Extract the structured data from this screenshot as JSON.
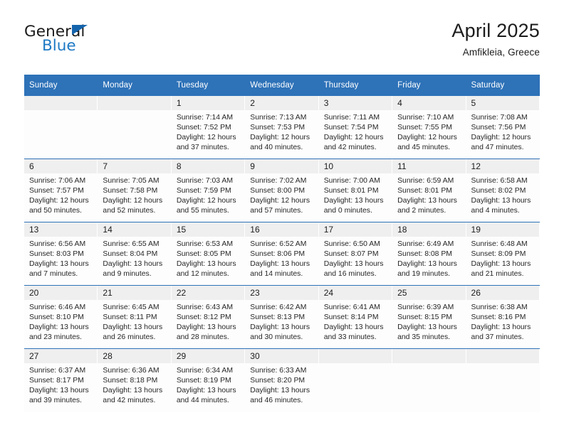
{
  "brand": {
    "name_top": "General",
    "name_bottom": "Blue",
    "triangle_color": "#1464ad",
    "blue_color": "#1f7ac4"
  },
  "header": {
    "title": "April 2025",
    "subtitle": "Amfikleia, Greece"
  },
  "theme": {
    "header_blue": "#2e72b8",
    "day_band_gray": "#efefef",
    "row_rule": "#2e72b8"
  },
  "weekday_headers": [
    "Sunday",
    "Monday",
    "Tuesday",
    "Wednesday",
    "Thursday",
    "Friday",
    "Saturday"
  ],
  "weeks": [
    [
      {
        "day": "",
        "sunrise": "",
        "sunset": "",
        "daylight1": "",
        "daylight2": "",
        "blank": true
      },
      {
        "day": "",
        "sunrise": "",
        "sunset": "",
        "daylight1": "",
        "daylight2": "",
        "blank": true
      },
      {
        "day": "1",
        "sunrise": "Sunrise: 7:14 AM",
        "sunset": "Sunset: 7:52 PM",
        "daylight1": "Daylight: 12 hours",
        "daylight2": "and 37 minutes."
      },
      {
        "day": "2",
        "sunrise": "Sunrise: 7:13 AM",
        "sunset": "Sunset: 7:53 PM",
        "daylight1": "Daylight: 12 hours",
        "daylight2": "and 40 minutes."
      },
      {
        "day": "3",
        "sunrise": "Sunrise: 7:11 AM",
        "sunset": "Sunset: 7:54 PM",
        "daylight1": "Daylight: 12 hours",
        "daylight2": "and 42 minutes."
      },
      {
        "day": "4",
        "sunrise": "Sunrise: 7:10 AM",
        "sunset": "Sunset: 7:55 PM",
        "daylight1": "Daylight: 12 hours",
        "daylight2": "and 45 minutes."
      },
      {
        "day": "5",
        "sunrise": "Sunrise: 7:08 AM",
        "sunset": "Sunset: 7:56 PM",
        "daylight1": "Daylight: 12 hours",
        "daylight2": "and 47 minutes."
      }
    ],
    [
      {
        "day": "6",
        "sunrise": "Sunrise: 7:06 AM",
        "sunset": "Sunset: 7:57 PM",
        "daylight1": "Daylight: 12 hours",
        "daylight2": "and 50 minutes."
      },
      {
        "day": "7",
        "sunrise": "Sunrise: 7:05 AM",
        "sunset": "Sunset: 7:58 PM",
        "daylight1": "Daylight: 12 hours",
        "daylight2": "and 52 minutes."
      },
      {
        "day": "8",
        "sunrise": "Sunrise: 7:03 AM",
        "sunset": "Sunset: 7:59 PM",
        "daylight1": "Daylight: 12 hours",
        "daylight2": "and 55 minutes."
      },
      {
        "day": "9",
        "sunrise": "Sunrise: 7:02 AM",
        "sunset": "Sunset: 8:00 PM",
        "daylight1": "Daylight: 12 hours",
        "daylight2": "and 57 minutes."
      },
      {
        "day": "10",
        "sunrise": "Sunrise: 7:00 AM",
        "sunset": "Sunset: 8:01 PM",
        "daylight1": "Daylight: 13 hours",
        "daylight2": "and 0 minutes."
      },
      {
        "day": "11",
        "sunrise": "Sunrise: 6:59 AM",
        "sunset": "Sunset: 8:01 PM",
        "daylight1": "Daylight: 13 hours",
        "daylight2": "and 2 minutes."
      },
      {
        "day": "12",
        "sunrise": "Sunrise: 6:58 AM",
        "sunset": "Sunset: 8:02 PM",
        "daylight1": "Daylight: 13 hours",
        "daylight2": "and 4 minutes."
      }
    ],
    [
      {
        "day": "13",
        "sunrise": "Sunrise: 6:56 AM",
        "sunset": "Sunset: 8:03 PM",
        "daylight1": "Daylight: 13 hours",
        "daylight2": "and 7 minutes."
      },
      {
        "day": "14",
        "sunrise": "Sunrise: 6:55 AM",
        "sunset": "Sunset: 8:04 PM",
        "daylight1": "Daylight: 13 hours",
        "daylight2": "and 9 minutes."
      },
      {
        "day": "15",
        "sunrise": "Sunrise: 6:53 AM",
        "sunset": "Sunset: 8:05 PM",
        "daylight1": "Daylight: 13 hours",
        "daylight2": "and 12 minutes."
      },
      {
        "day": "16",
        "sunrise": "Sunrise: 6:52 AM",
        "sunset": "Sunset: 8:06 PM",
        "daylight1": "Daylight: 13 hours",
        "daylight2": "and 14 minutes."
      },
      {
        "day": "17",
        "sunrise": "Sunrise: 6:50 AM",
        "sunset": "Sunset: 8:07 PM",
        "daylight1": "Daylight: 13 hours",
        "daylight2": "and 16 minutes."
      },
      {
        "day": "18",
        "sunrise": "Sunrise: 6:49 AM",
        "sunset": "Sunset: 8:08 PM",
        "daylight1": "Daylight: 13 hours",
        "daylight2": "and 19 minutes."
      },
      {
        "day": "19",
        "sunrise": "Sunrise: 6:48 AM",
        "sunset": "Sunset: 8:09 PM",
        "daylight1": "Daylight: 13 hours",
        "daylight2": "and 21 minutes."
      }
    ],
    [
      {
        "day": "20",
        "sunrise": "Sunrise: 6:46 AM",
        "sunset": "Sunset: 8:10 PM",
        "daylight1": "Daylight: 13 hours",
        "daylight2": "and 23 minutes."
      },
      {
        "day": "21",
        "sunrise": "Sunrise: 6:45 AM",
        "sunset": "Sunset: 8:11 PM",
        "daylight1": "Daylight: 13 hours",
        "daylight2": "and 26 minutes."
      },
      {
        "day": "22",
        "sunrise": "Sunrise: 6:43 AM",
        "sunset": "Sunset: 8:12 PM",
        "daylight1": "Daylight: 13 hours",
        "daylight2": "and 28 minutes."
      },
      {
        "day": "23",
        "sunrise": "Sunrise: 6:42 AM",
        "sunset": "Sunset: 8:13 PM",
        "daylight1": "Daylight: 13 hours",
        "daylight2": "and 30 minutes."
      },
      {
        "day": "24",
        "sunrise": "Sunrise: 6:41 AM",
        "sunset": "Sunset: 8:14 PM",
        "daylight1": "Daylight: 13 hours",
        "daylight2": "and 33 minutes."
      },
      {
        "day": "25",
        "sunrise": "Sunrise: 6:39 AM",
        "sunset": "Sunset: 8:15 PM",
        "daylight1": "Daylight: 13 hours",
        "daylight2": "and 35 minutes."
      },
      {
        "day": "26",
        "sunrise": "Sunrise: 6:38 AM",
        "sunset": "Sunset: 8:16 PM",
        "daylight1": "Daylight: 13 hours",
        "daylight2": "and 37 minutes."
      }
    ],
    [
      {
        "day": "27",
        "sunrise": "Sunrise: 6:37 AM",
        "sunset": "Sunset: 8:17 PM",
        "daylight1": "Daylight: 13 hours",
        "daylight2": "and 39 minutes."
      },
      {
        "day": "28",
        "sunrise": "Sunrise: 6:36 AM",
        "sunset": "Sunset: 8:18 PM",
        "daylight1": "Daylight: 13 hours",
        "daylight2": "and 42 minutes."
      },
      {
        "day": "29",
        "sunrise": "Sunrise: 6:34 AM",
        "sunset": "Sunset: 8:19 PM",
        "daylight1": "Daylight: 13 hours",
        "daylight2": "and 44 minutes."
      },
      {
        "day": "30",
        "sunrise": "Sunrise: 6:33 AM",
        "sunset": "Sunset: 8:20 PM",
        "daylight1": "Daylight: 13 hours",
        "daylight2": "and 46 minutes."
      },
      {
        "day": "",
        "sunrise": "",
        "sunset": "",
        "daylight1": "",
        "daylight2": "",
        "blank": true
      },
      {
        "day": "",
        "sunrise": "",
        "sunset": "",
        "daylight1": "",
        "daylight2": "",
        "blank": true
      },
      {
        "day": "",
        "sunrise": "",
        "sunset": "",
        "daylight1": "",
        "daylight2": "",
        "blank": true
      }
    ]
  ]
}
